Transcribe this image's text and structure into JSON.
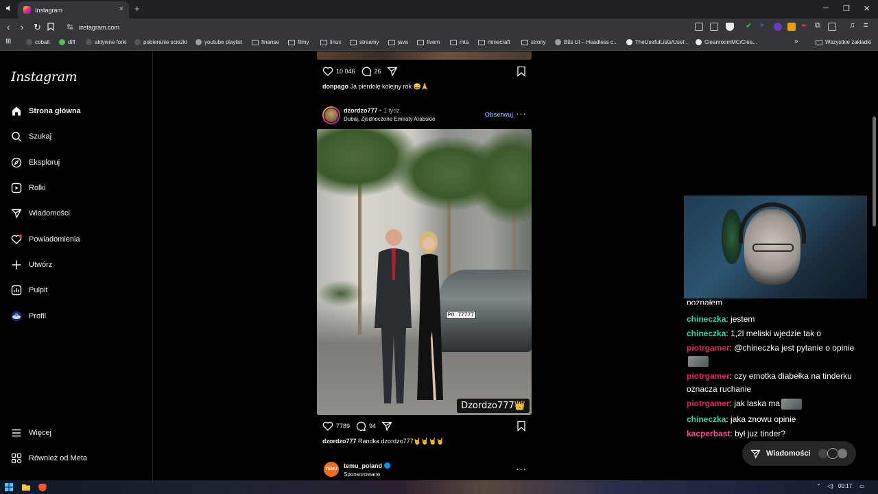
{
  "browser": {
    "tab_title": "Instagram",
    "tab_close": "×",
    "new_tab": "+",
    "url": "instagram.com",
    "window_controls": {
      "minimize": "─",
      "restore": "❐",
      "close": "✕"
    }
  },
  "bookmarks": [
    {
      "label": "cobalt",
      "icon": "cobalt-icon"
    },
    {
      "label": "diff",
      "icon": "diff-icon"
    },
    {
      "label": "aktywne forki",
      "icon": "page-icon"
    },
    {
      "label": "pobieranie sciezki",
      "icon": "page-icon"
    },
    {
      "label": "youtube playlist",
      "icon": "globe-icon"
    },
    {
      "label": "finanse",
      "icon": "folder-icon"
    },
    {
      "label": "filmy",
      "icon": "folder-icon"
    },
    {
      "label": "linux",
      "icon": "folder-icon"
    },
    {
      "label": "streamy",
      "icon": "folder-icon"
    },
    {
      "label": "java",
      "icon": "folder-icon"
    },
    {
      "label": "fivem",
      "icon": "folder-icon"
    },
    {
      "label": "mta",
      "icon": "folder-icon"
    },
    {
      "label": "minecraft",
      "icon": "folder-icon"
    },
    {
      "label": "strony",
      "icon": "folder-icon"
    },
    {
      "label": "Bits UI – Headless c...",
      "icon": "globe-icon"
    },
    {
      "label": "TheUsefulLists/Usef...",
      "icon": "github-icon"
    },
    {
      "label": "CleanroomMC/Clea...",
      "icon": "github-icon"
    }
  ],
  "bookmarks_more": "»",
  "bookmarks_all": "Wszystkie zakładki",
  "sidebar": {
    "logo": "Instagram",
    "items": [
      {
        "label": "Strona główna",
        "icon": "home-icon",
        "active": true
      },
      {
        "label": "Szukaj",
        "icon": "search-icon"
      },
      {
        "label": "Eksploruj",
        "icon": "compass-icon"
      },
      {
        "label": "Rolki",
        "icon": "reels-icon"
      },
      {
        "label": "Wiadomości",
        "icon": "messenger-icon"
      },
      {
        "label": "Powiadomienia",
        "icon": "heart-icon"
      },
      {
        "label": "Utwórz",
        "icon": "plus-icon"
      },
      {
        "label": "Pulpit",
        "icon": "dashboard-icon"
      },
      {
        "label": "Profil",
        "icon": "profile-avatar"
      }
    ],
    "bottom_items": [
      {
        "label": "Więcej",
        "icon": "menu-icon"
      },
      {
        "label": "Również od Meta",
        "icon": "meta-grid-icon"
      }
    ]
  },
  "post_prev": {
    "likes": "10 046",
    "comments": "26",
    "caption_user": "donpago",
    "caption_text": "Ja pierdolę kolejny rok 😀🙏"
  },
  "post_main": {
    "username": "dzordzo777",
    "separator": "•",
    "time": "1 tydz.",
    "location": "Dubaj, Zjednoczone Emiraty Arabskie",
    "follow": "Obserwuj",
    "more": "···",
    "plate": "PO 77777",
    "watermark": "Dzordzo777👑",
    "likes": "7789",
    "comments": "94",
    "caption_user": "dzordzo777",
    "caption_text": "Randka dzordzo777🤘🤘🤘🤘"
  },
  "post_next": {
    "username": "temu_poland",
    "sponsored": "Sponsorowane",
    "avatar_text": "TEMU",
    "more": "···"
  },
  "chat": [
    {
      "user": "",
      "text": "poznałem",
      "color": "#ffffff"
    },
    {
      "user": "chineczka",
      "text": ": jestem",
      "color": "#2bd8a8"
    },
    {
      "user": "chineczka",
      "text": ": 1,2l meliski wjedzie tak o",
      "color": "#2bd8a8"
    },
    {
      "user": "piotrgamer",
      "text": ": @chineczka jest pytanie o opinie",
      "color": "#e0245e",
      "emote": true
    },
    {
      "user": "piotrgamer",
      "text": ": czy emotka diabełka na tinderku oznacza ruchanie",
      "color": "#e0245e"
    },
    {
      "user": "piotrgamer",
      "text": ": jak laska ma",
      "color": "#e0245e",
      "emote": true
    },
    {
      "user": "chineczka",
      "text": ": jaka znowu opinie",
      "color": "#2bd8a8"
    },
    {
      "user": "kacperbast",
      "text": ": był juz tinder?",
      "color": "#ff4d8f"
    }
  ],
  "dm_pill": {
    "label": "Wiadomości"
  },
  "taskbar": {
    "time": "00:17"
  }
}
